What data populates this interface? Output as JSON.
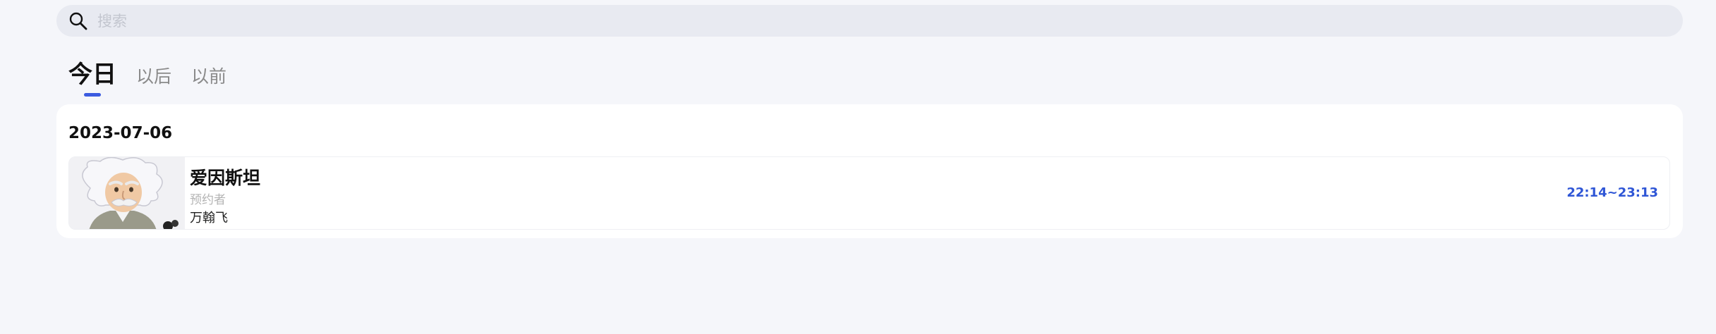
{
  "search": {
    "placeholder": "搜索",
    "value": "",
    "icon": "search-icon"
  },
  "tabs": [
    {
      "label": "今日",
      "active": true
    },
    {
      "label": "以后",
      "active": false
    },
    {
      "label": "以前",
      "active": false
    }
  ],
  "accent_color": "#3b5be0",
  "sections": [
    {
      "date": "2023-07-06",
      "items": [
        {
          "title": "爱因斯坦",
          "role_label": "预约者",
          "person": "万翰飞",
          "time": "22:14~23:13",
          "avatar": "einstein-cartoon-avatar"
        }
      ]
    }
  ]
}
